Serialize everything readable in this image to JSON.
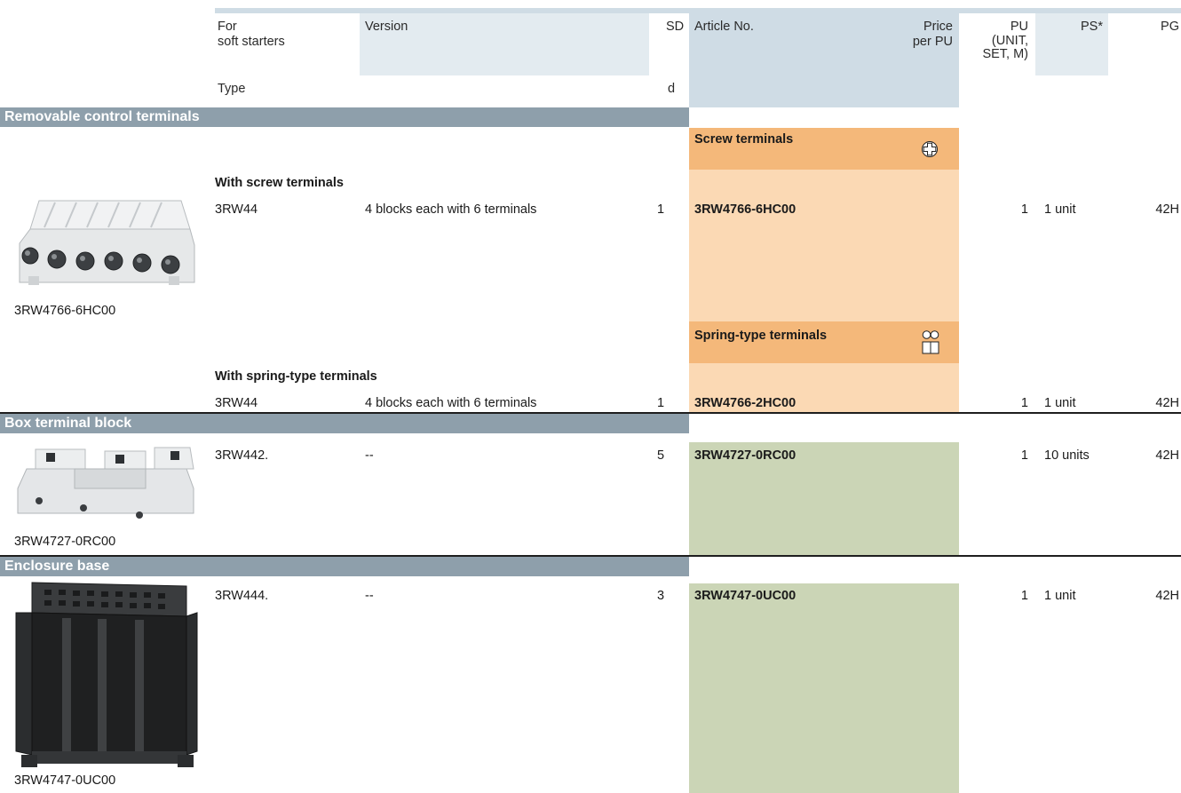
{
  "header": {
    "for_soft_starters": [
      "For",
      "soft starters"
    ],
    "version": "Version",
    "sd": "SD",
    "article_no": "Article No.",
    "price_per_pu": [
      "Price",
      "per PU"
    ],
    "pu": [
      "PU",
      "(UNIT,",
      "SET, M)"
    ],
    "ps": "PS*",
    "pg": "PG",
    "type": "Type",
    "sd_unit": "d"
  },
  "sections": {
    "removable": {
      "title": "Removable control terminals",
      "screw_header": "Screw terminals",
      "spring_header": "Spring-type terminals",
      "screw_group": "With screw terminals",
      "spring_group": "With spring-type terminals",
      "image_caption": "3RW4766-6HC00",
      "rows": [
        {
          "type": "3RW44",
          "version": "4 blocks each with 6 terminals",
          "sd": "1",
          "article": "3RW4766-6HC00",
          "pu": "1",
          "ps": "1 unit",
          "pg": "42H"
        },
        {
          "type": "3RW44",
          "version": "4 blocks each with 6 terminals",
          "sd": "1",
          "article": "3RW4766-2HC00",
          "pu": "1",
          "ps": "1 unit",
          "pg": "42H"
        }
      ]
    },
    "box": {
      "title": "Box terminal block",
      "image_caption": "3RW4727-0RC00",
      "row": {
        "type": "3RW442.",
        "version": "--",
        "sd": "5",
        "article": "3RW4727-0RC00",
        "pu": "1",
        "ps": "10 units",
        "pg": "42H"
      }
    },
    "enclosure": {
      "title": "Enclosure base",
      "image_caption": "3RW4747-0UC00",
      "row": {
        "type": "3RW444.",
        "version": "--",
        "sd": "3",
        "article": "3RW4747-0UC00",
        "pu": "1",
        "ps": "1 unit",
        "pg": "42H"
      }
    }
  },
  "icons": {
    "screw": "screw-terminal-icon",
    "spring": "spring-terminal-icon"
  },
  "colors": {
    "header_blue": "#cfdce5",
    "section_gray": "#8e9fab",
    "orange_dark": "#f4b87a",
    "orange_light": "#fbd9b4",
    "green": "#cbd5b6"
  }
}
